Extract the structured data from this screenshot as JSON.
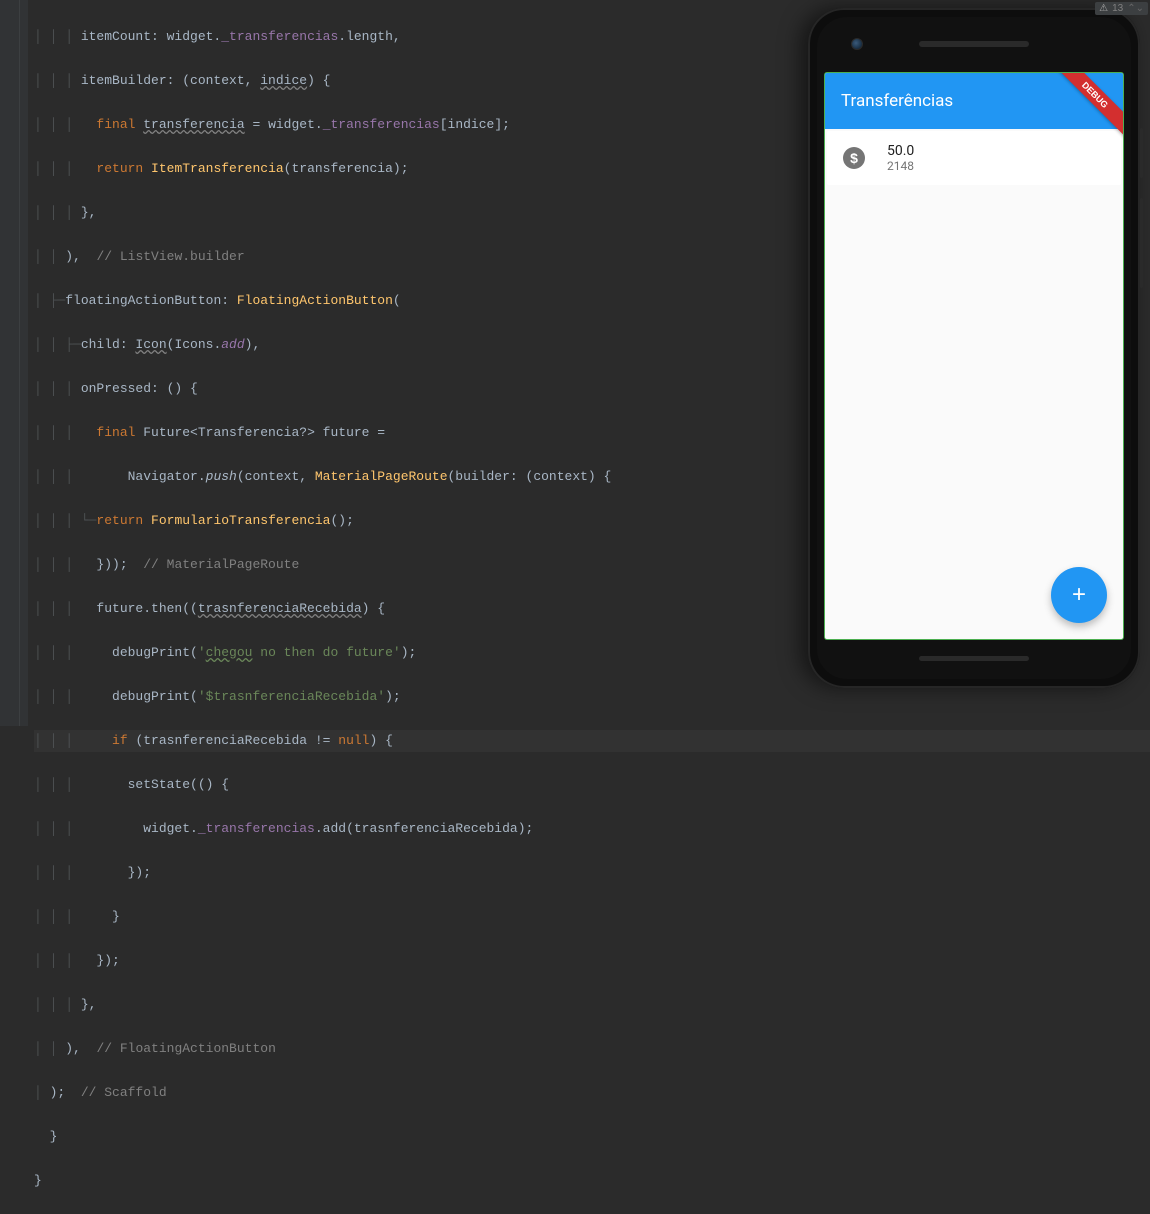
{
  "analysis": {
    "warning_icon": "⚠",
    "count": "13"
  },
  "code": {
    "l1": "        itemCount: widget._transferencias.length,",
    "l2": "        itemBuilder: (context, indice) {",
    "l3": "          final transferencia = widget._transferencias[indice];",
    "l4": "          return ItemTransferencia(transferencia);",
    "l5": "        },",
    "l6": "      ),  // ListView.builder",
    "l7": "      floatingActionButton: FloatingActionButton(",
    "l8": "        child: Icon(Icons.add),",
    "l9": "        onPressed: () {",
    "l10": "          final Future<Transferencia?> future =",
    "l11": "              Navigator.push(context, MaterialPageRoute(builder: (context) {",
    "l12": "            return FormularioTransferencia();",
    "l13": "          }));  // MaterialPageRoute",
    "l14": "          future.then((trasnferenciaRecebida) {",
    "l15": "            debugPrint('chegou no then do future');",
    "l16": "            debugPrint('$trasnferenciaRecebida');",
    "l17": "            if (trasnferenciaRecebida != null) {",
    "l18": "              setState(() {",
    "l19": "                widget._transferencias.add(trasnferenciaRecebida);",
    "l20": "              });",
    "l21": "            }",
    "l22": "          });",
    "l23": "        },",
    "l24": "      ),  // FloatingActionButton",
    "l25": "    );  // Scaffold",
    "l26": "  }",
    "l27": "}"
  },
  "emulator": {
    "appbar_title": "Transferências",
    "debug_label": "DEBUG",
    "items": [
      {
        "amount": "50.0",
        "account": "2148"
      }
    ],
    "fab_icon": "+"
  }
}
